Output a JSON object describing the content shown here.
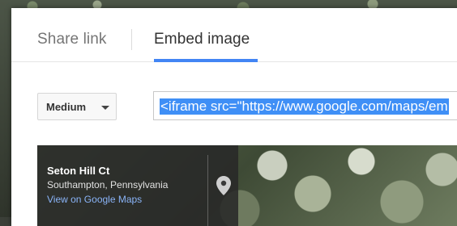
{
  "tabs": {
    "share": "Share link",
    "embed": "Embed image"
  },
  "size_select": {
    "selected": "Medium"
  },
  "embed_field": {
    "value": "<iframe src=\"https://www.google.com/maps/em"
  },
  "preview": {
    "title": "Seton Hill Ct",
    "subtitle": "Southampton, Pennsylvania",
    "link": "View on Google Maps"
  },
  "colors": {
    "accent": "#4285f4",
    "selection": "#3f8ff6"
  },
  "icons": {
    "pin": "map-pin-icon",
    "dropdown": "chevron-down-icon"
  }
}
